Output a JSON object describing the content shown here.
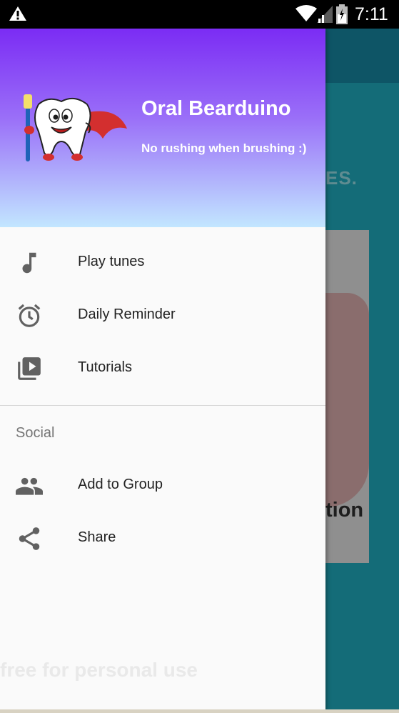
{
  "status_bar": {
    "time": "7:11",
    "icons": [
      "warning-icon",
      "wifi-icon",
      "signal-icon",
      "battery-icon"
    ]
  },
  "background_app": {
    "text_top": "ES.",
    "text_bottom": "tion"
  },
  "drawer": {
    "header": {
      "app_name": "Oral Bearduino",
      "tagline": "No rushing when brushing :)",
      "gradient_top": "#7b2cf4",
      "gradient_bottom": "#c2e6ff"
    },
    "items": [
      {
        "label": "Play tunes",
        "icon": "music-note-icon"
      },
      {
        "label": "Daily Reminder",
        "icon": "alarm-icon"
      },
      {
        "label": "Tutorials",
        "icon": "video-library-icon"
      }
    ],
    "social": {
      "title": "Social",
      "items": [
        {
          "label": "Add to Group",
          "icon": "group-icon"
        },
        {
          "label": "Share",
          "icon": "share-icon"
        }
      ]
    }
  },
  "watermark": "free for personal use"
}
